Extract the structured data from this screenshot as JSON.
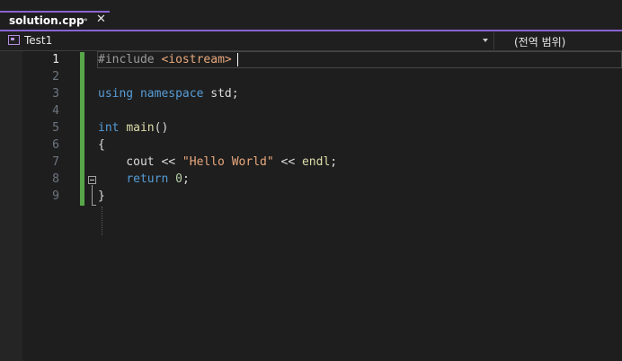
{
  "tab": {
    "title": "solution.cpp",
    "pin_icon": "pin-icon",
    "close_icon": "close-icon"
  },
  "navbar": {
    "project": "Test1",
    "scope": "(전역 범위)"
  },
  "editor": {
    "current_line": 1,
    "line_numbers": [
      "1",
      "2",
      "3",
      "4",
      "5",
      "6",
      "7",
      "8",
      "9"
    ],
    "lines": [
      [
        {
          "t": "pp",
          "v": "#include "
        },
        {
          "t": "str",
          "v": "<iostream>"
        }
      ],
      [],
      [
        {
          "t": "kw",
          "v": "using"
        },
        {
          "t": "plain",
          "v": " "
        },
        {
          "t": "kw",
          "v": "namespace"
        },
        {
          "t": "plain",
          "v": " std;"
        }
      ],
      [],
      [
        {
          "t": "kw",
          "v": "int"
        },
        {
          "t": "plain",
          "v": " "
        },
        {
          "t": "fn",
          "v": "main"
        },
        {
          "t": "plain",
          "v": "()"
        }
      ],
      [
        {
          "t": "plain",
          "v": "{"
        }
      ],
      [
        {
          "t": "plain",
          "v": "    cout << "
        },
        {
          "t": "str",
          "v": "\"Hello World\""
        },
        {
          "t": "plain",
          "v": " << "
        },
        {
          "t": "fn",
          "v": "endl"
        },
        {
          "t": "plain",
          "v": ";"
        }
      ],
      [
        {
          "t": "plain",
          "v": "    "
        },
        {
          "t": "kw",
          "v": "return"
        },
        {
          "t": "plain",
          "v": " "
        },
        {
          "t": "num",
          "v": "0"
        },
        {
          "t": "plain",
          "v": ";"
        }
      ],
      [
        {
          "t": "plain",
          "v": "}"
        }
      ]
    ]
  },
  "colors": {
    "accent": "#8a63d2",
    "change_bar": "#57a64a",
    "keyword": "#569cd6",
    "string": "#e8a87c",
    "function": "#dcdcaa",
    "number": "#b5cea8"
  }
}
